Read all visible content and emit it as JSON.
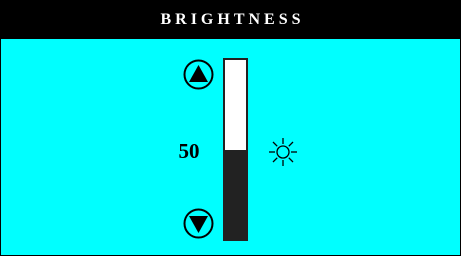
{
  "title": "BRIGHTNESS",
  "brightness": {
    "value_label": "50",
    "level": 0.5
  },
  "controls": {
    "increase_icon": "triangle-up-circle",
    "decrease_icon": "triangle-down-circle",
    "indicator_icon": "sun-icon"
  },
  "colors": {
    "background": "#00ffff",
    "title_bar": "#000000",
    "title_text": "#ffffff",
    "slider_fill": "#222222",
    "slider_empty": "#ffffff"
  }
}
